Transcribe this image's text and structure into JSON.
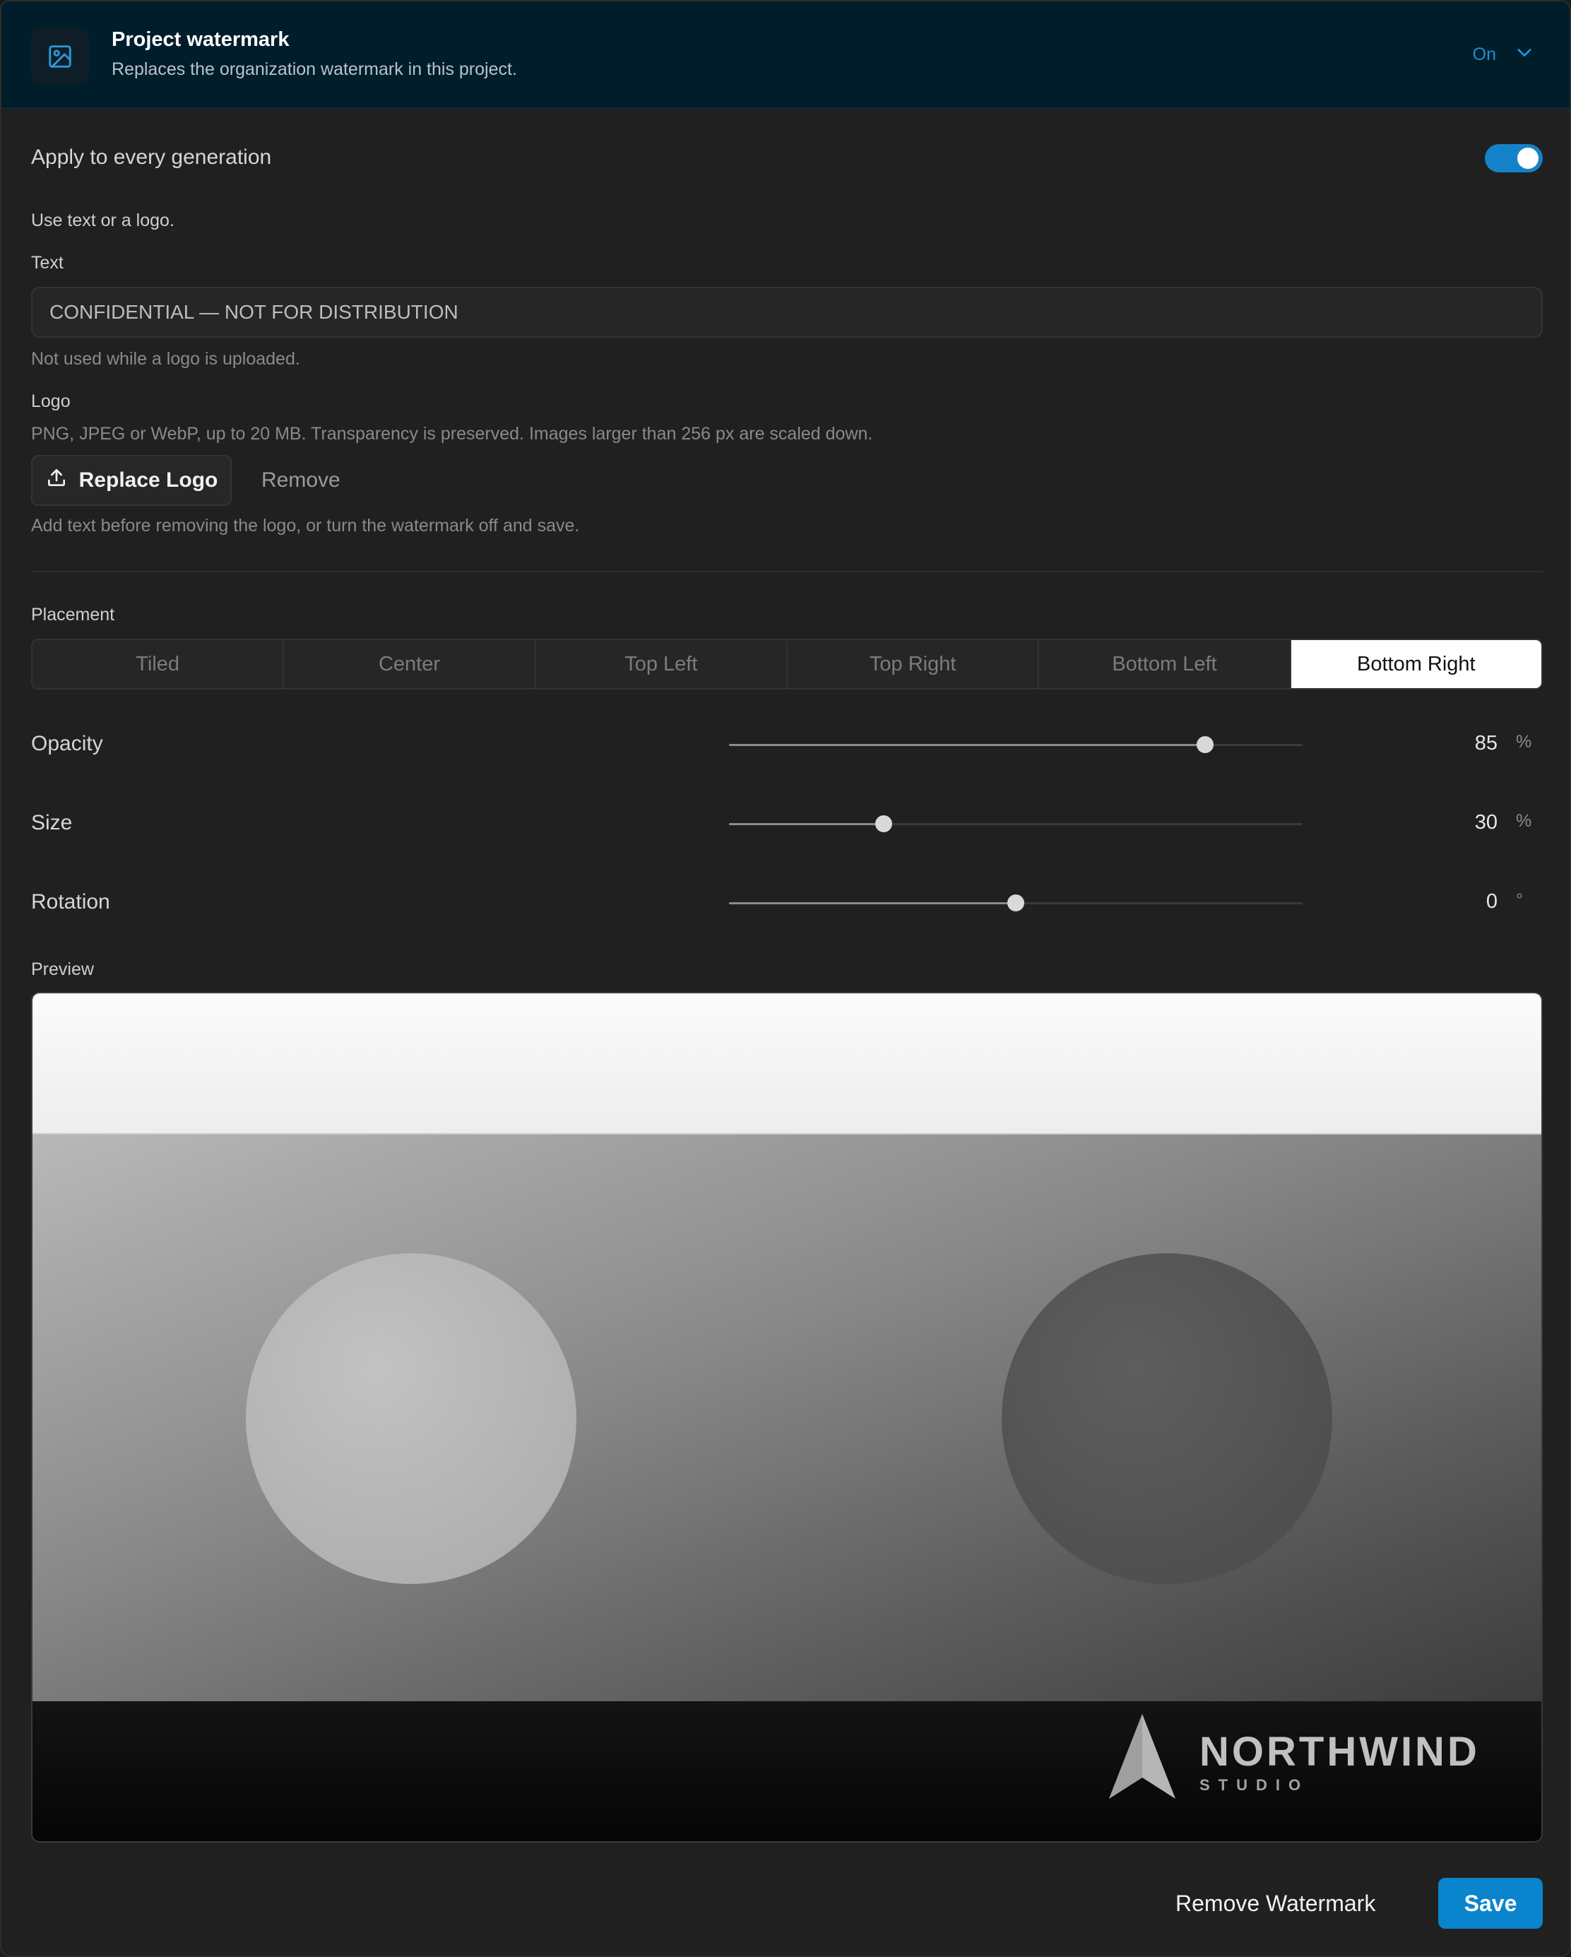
{
  "header": {
    "title": "Project watermark",
    "subtitle": "Replaces the organization watermark in this project.",
    "status": "On",
    "icon": "image-icon",
    "expand_icon": "chevron-down-icon"
  },
  "apply": {
    "label": "Apply to every generation",
    "enabled": true
  },
  "source_hint": "Use text or a logo.",
  "text_field": {
    "label": "Text",
    "value": "CONFIDENTIAL — NOT FOR DISTRIBUTION",
    "help": "Not used while a logo is uploaded."
  },
  "logo": {
    "label": "Logo",
    "help": "PNG, JPEG or WebP, up to 20 MB. Transparency is preserved. Images larger than 256 px are scaled down.",
    "replace_label": "Replace Logo",
    "replace_icon": "upload-icon",
    "remove_label": "Remove",
    "note": "Add text before removing the logo, or turn the watermark off and save."
  },
  "placement": {
    "label": "Placement",
    "options": [
      "Tiled",
      "Center",
      "Top Left",
      "Top Right",
      "Bottom Left",
      "Bottom Right"
    ],
    "selected": "Bottom Right"
  },
  "sliders": {
    "opacity": {
      "label": "Opacity",
      "value": "85",
      "unit": "%",
      "fraction": 0.83
    },
    "size": {
      "label": "Size",
      "value": "30",
      "unit": "%",
      "fraction": 0.27
    },
    "rotation": {
      "label": "Rotation",
      "value": "0",
      "unit": "°",
      "fraction": 0.5
    }
  },
  "preview": {
    "label": "Preview",
    "watermark_name": "NORTHWIND",
    "watermark_sub": "STUDIO"
  },
  "footer": {
    "remove_watermark_label": "Remove Watermark",
    "save_label": "Save"
  },
  "colors": {
    "accent": "#0a84cc",
    "header_bg": "#001d2b",
    "panel_bg": "#202020"
  }
}
